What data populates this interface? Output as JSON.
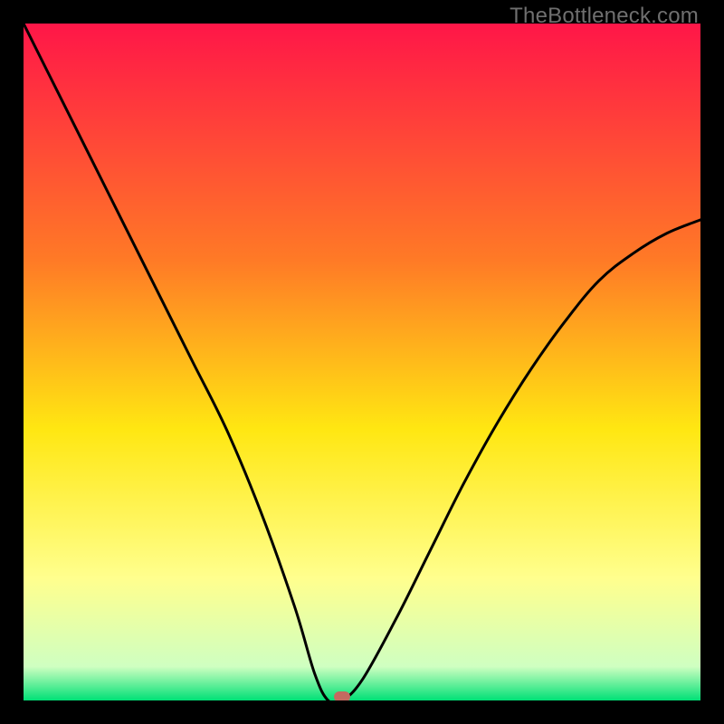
{
  "watermark": "TheBottleneck.com",
  "chart_data": {
    "type": "line",
    "title": "",
    "xlabel": "",
    "ylabel": "",
    "xlim": [
      0,
      100
    ],
    "ylim": [
      0,
      100
    ],
    "grid": false,
    "legend": false,
    "background_gradient": {
      "stops": [
        {
          "pos": 0,
          "color": "#ff1648"
        },
        {
          "pos": 35,
          "color": "#ff7a26"
        },
        {
          "pos": 60,
          "color": "#ffe712"
        },
        {
          "pos": 82,
          "color": "#ffff8e"
        },
        {
          "pos": 95,
          "color": "#cfffc1"
        },
        {
          "pos": 100,
          "color": "#00e076"
        }
      ]
    },
    "series": [
      {
        "name": "bottleneck-curve",
        "x": [
          0,
          5,
          10,
          15,
          20,
          25,
          30,
          35,
          40,
          43,
          45,
          47,
          50,
          55,
          60,
          65,
          70,
          75,
          80,
          85,
          90,
          95,
          100
        ],
        "y": [
          100,
          90,
          80,
          70,
          60,
          50,
          40,
          28,
          14,
          4,
          0,
          0,
          3,
          12,
          22,
          32,
          41,
          49,
          56,
          62,
          66,
          69,
          71
        ]
      }
    ],
    "marker": {
      "x": 47,
      "y": 0,
      "color": "#c46a60"
    }
  }
}
